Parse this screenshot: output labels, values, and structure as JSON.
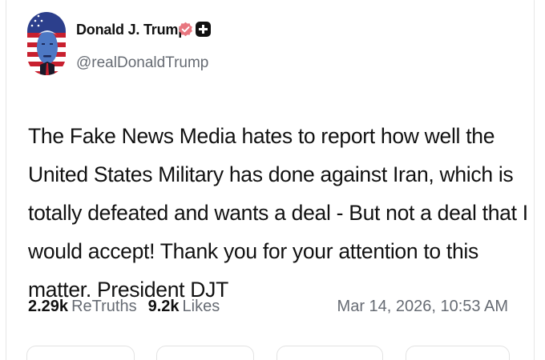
{
  "author": {
    "name": "Donald J. Trump",
    "handle": "@realDonaldTrump"
  },
  "post": {
    "text": "The Fake News Media hates to report how well the United States Military has done against Iran, which is totally defeated and wants a deal - But not a deal that I would accept! Thank you for your attention to this matter. President DJT",
    "timestamp": "Mar 14, 2026, 10:53 AM"
  },
  "stats": {
    "retruths_count": "2.29k",
    "retruths_label": "ReTruths",
    "likes_count": "9.2k",
    "likes_label": "Likes"
  },
  "icons": {
    "verified": "verified-badge-icon",
    "plus": "plus-badge-icon"
  },
  "colors": {
    "verified_badge": "#e8767f",
    "muted_text": "#666b73"
  }
}
